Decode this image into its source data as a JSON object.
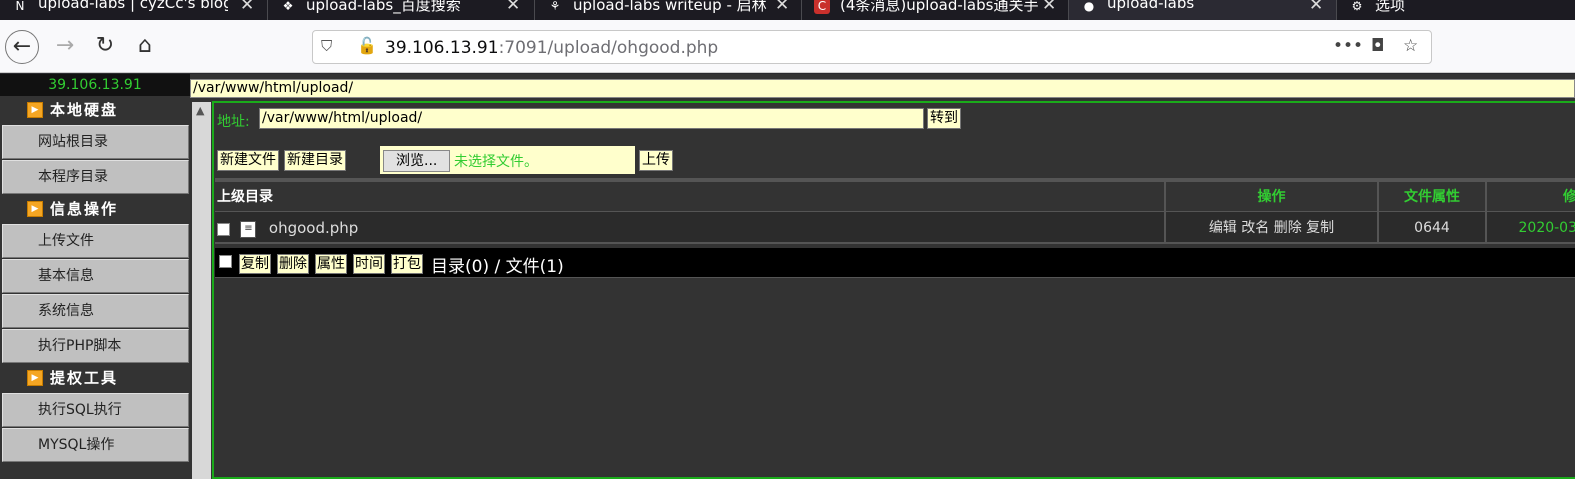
{
  "tabs": [
    {
      "icon": "N",
      "title": "upload-labs | cyzCc's blog"
    },
    {
      "icon": "baidu-paw-icon",
      "title": "upload-labs_百度搜索"
    },
    {
      "icon": "plant-icon",
      "title": "upload-labs writeup - 启林"
    },
    {
      "icon": "C",
      "title": "(4条消息)upload-labs通关手"
    },
    {
      "icon": "github-icon",
      "title": "upload-labs"
    }
  ],
  "settings_tab": {
    "title": "选项"
  },
  "url": {
    "host": "39.106.13.91",
    "rest": ":7091/upload/ohgood.php"
  },
  "sidebar": {
    "ip": "39.106.13.91",
    "sections": [
      {
        "heading": "本地硬盘",
        "items": [
          "网站根目录",
          "本程序目录"
        ]
      },
      {
        "heading": "信息操作",
        "items": [
          "上传文件",
          "基本信息",
          "系统信息",
          "执行PHP脚本"
        ]
      },
      {
        "heading": "提权工具",
        "items": [
          "执行SQL执行",
          "MYSQL操作"
        ]
      }
    ]
  },
  "path_bar": "/var/www/html/upload/",
  "address": {
    "label": "地址:",
    "value": "/var/www/html/upload/",
    "go": "转到"
  },
  "actions": {
    "new_file": "新建文件",
    "new_dir": "新建目录",
    "browse": "浏览...",
    "no_file": "未选择文件。",
    "upload": "上传"
  },
  "table": {
    "headers": {
      "parent": "上级目录",
      "ops": "操作",
      "attr": "文件属性",
      "time": "修"
    },
    "rows": [
      {
        "name": "ohgood.php",
        "ops": "编辑 改名 删除 复制",
        "perm": "0644",
        "time": "2020-03"
      }
    ]
  },
  "footer": {
    "copy": "复制",
    "delete": "删除",
    "attr": "属性",
    "time": "时间",
    "pack": "打包",
    "count": "目录(0) / 文件(1)"
  },
  "colors": {
    "green": "#32cd32",
    "frame": "#1aab1a",
    "input_bg": "#ffffcc"
  }
}
